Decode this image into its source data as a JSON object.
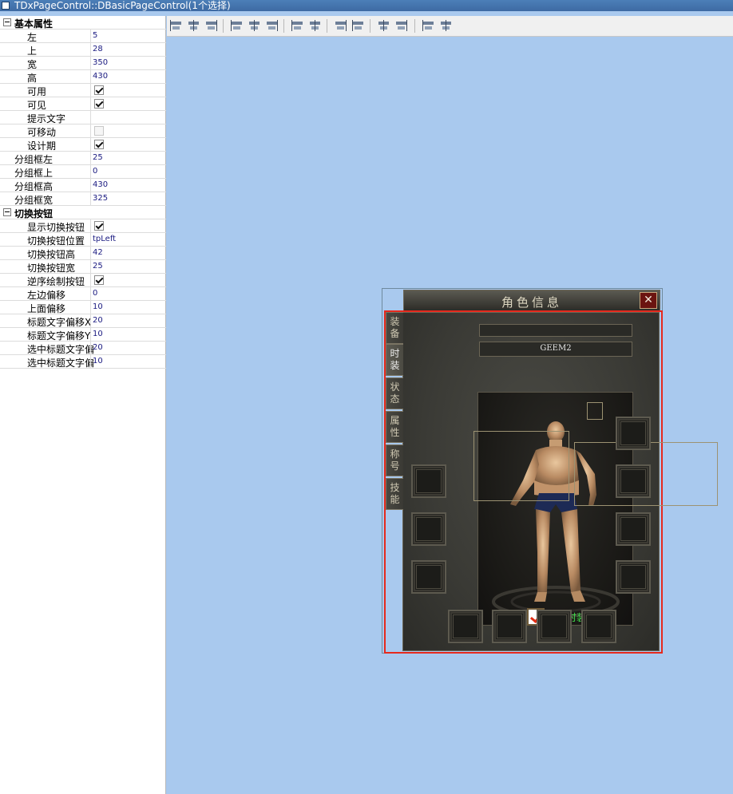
{
  "window": {
    "title": "TDxPageControl::DBasicPageControl(1个选择)"
  },
  "inspector": {
    "categories": [
      {
        "label": "基本属性",
        "rows": [
          {
            "name": "左",
            "value": "5"
          },
          {
            "name": "上",
            "value": "28"
          },
          {
            "name": "宽",
            "value": "350"
          },
          {
            "name": "高",
            "value": "430"
          },
          {
            "name": "可用",
            "checked": true
          },
          {
            "name": "可见",
            "checked": true
          },
          {
            "name": "提示文字",
            "value": ""
          },
          {
            "name": "可移动",
            "checked": false
          },
          {
            "name": "设计期",
            "checked": true
          },
          {
            "name": "分组框左",
            "value": "25"
          },
          {
            "name": "分组框上",
            "value": "0"
          },
          {
            "name": "分组框高",
            "value": "430"
          },
          {
            "name": "分组框宽",
            "value": "325"
          }
        ]
      },
      {
        "label": "切换按钮",
        "rows": [
          {
            "name": "显示切换按钮",
            "checked": true
          },
          {
            "name": "切换按钮位置",
            "value": "tpLeft"
          },
          {
            "name": "切换按钮高",
            "value": "42"
          },
          {
            "name": "切换按钮宽",
            "value": "25"
          },
          {
            "name": "逆序绘制按钮",
            "checked": true
          },
          {
            "name": "左边偏移",
            "value": "0"
          },
          {
            "name": "上面偏移",
            "value": "10"
          },
          {
            "name": "标题文字偏移X",
            "value": "20"
          },
          {
            "name": "标题文字偏移Y",
            "value": "10"
          },
          {
            "name": "选中标题文字偏",
            "value": "20"
          },
          {
            "name": "选中标题文字偏",
            "value": "10"
          }
        ]
      }
    ]
  },
  "game_window": {
    "title": "角色信息",
    "close_glyph": "✕",
    "tabs": [
      {
        "label": "装备"
      },
      {
        "label": "时装"
      },
      {
        "label": "状态"
      },
      {
        "label": "属性"
      },
      {
        "label": "称号"
      },
      {
        "label": "技能"
      }
    ],
    "character_name": "GEEM2",
    "fashion_checkbox": {
      "label": "外显时装",
      "checked": true
    }
  },
  "colors": {
    "canvas": "#a9c9ee",
    "selection_frame": "#e6291d",
    "fashion_label": "#41e04b"
  }
}
